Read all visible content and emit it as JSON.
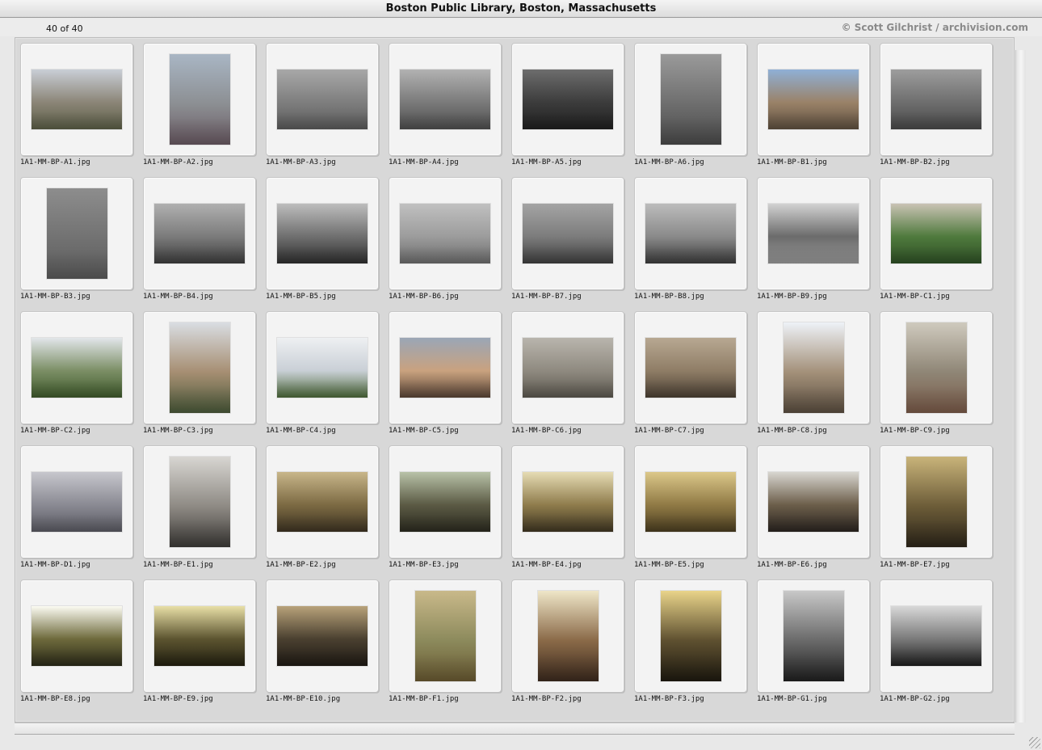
{
  "window": {
    "title": "Boston Public Library, Boston, Massachusetts"
  },
  "info": {
    "count": "40 of 40",
    "credit": "© Scott Gilchrist / archivision.com"
  },
  "slides": [
    {
      "file": "1A1-MM-BP-A1.jpg",
      "orient": "landscape",
      "tone": [
        "#c9ced6",
        "#8b8577",
        "#5b5e46"
      ]
    },
    {
      "file": "1A1-MM-BP-A2.jpg",
      "orient": "portrait",
      "tone": [
        "#a9b6c4",
        "#8c8f93",
        "#6a5a63"
      ]
    },
    {
      "file": "1A1-MM-BP-A3.jpg",
      "orient": "landscape",
      "tone": [
        "#a8a8a8",
        "#7e7e7e",
        "#5a5a5a"
      ]
    },
    {
      "file": "1A1-MM-BP-A4.jpg",
      "orient": "landscape",
      "tone": [
        "#b2b2b2",
        "#7a7a7a",
        "#4e4e4e"
      ]
    },
    {
      "file": "1A1-MM-BP-A5.jpg",
      "orient": "landscape",
      "tone": [
        "#6d6d6d",
        "#3c3c3c",
        "#1f1f1f"
      ]
    },
    {
      "file": "1A1-MM-BP-A6.jpg",
      "orient": "portrait",
      "tone": [
        "#9a9a9a",
        "#6e6e6e",
        "#4a4a4a"
      ]
    },
    {
      "file": "1A1-MM-BP-B1.jpg",
      "orient": "landscape",
      "tone": [
        "#8fb0d6",
        "#9a8268",
        "#5e4f3f"
      ]
    },
    {
      "file": "1A1-MM-BP-B2.jpg",
      "orient": "landscape",
      "tone": [
        "#9d9d9d",
        "#6e6e6e",
        "#484848"
      ]
    },
    {
      "file": "1A1-MM-BP-B3.jpg",
      "orient": "portrait",
      "tone": [
        "#8d8d8d",
        "#727272",
        "#5b5b5b"
      ]
    },
    {
      "file": "1A1-MM-BP-B4.jpg",
      "orient": "landscape",
      "tone": [
        "#b0b0b0",
        "#7b7b7b",
        "#3d3d3d"
      ]
    },
    {
      "file": "1A1-MM-BP-B5.jpg",
      "orient": "landscape",
      "tone": [
        "#bdbdbd",
        "#6f6f6f",
        "#2e2e2e"
      ]
    },
    {
      "file": "1A1-MM-BP-B6.jpg",
      "orient": "landscape",
      "tone": [
        "#c0c0c0",
        "#9c9c9c",
        "#6c6c6c"
      ]
    },
    {
      "file": "1A1-MM-BP-B7.jpg",
      "orient": "landscape",
      "tone": [
        "#a4a4a4",
        "#7c7c7c",
        "#3f3f3f"
      ]
    },
    {
      "file": "1A1-MM-BP-B8.jpg",
      "orient": "landscape",
      "tone": [
        "#bcbcbc",
        "#8a8a8a",
        "#3c3c3c"
      ]
    },
    {
      "file": "1A1-MM-BP-B9.jpg",
      "orient": "landscape",
      "tone": [
        "#d2d2d2",
        "#6b6b6b",
        "#9a9a9a"
      ]
    },
    {
      "file": "1A1-MM-BP-C1.jpg",
      "orient": "landscape",
      "tone": [
        "#c9c3b4",
        "#4f7a3d",
        "#2e4f25"
      ]
    },
    {
      "file": "1A1-MM-BP-C2.jpg",
      "orient": "landscape",
      "tone": [
        "#e2e6ea",
        "#7b8e65",
        "#3f5a2c"
      ]
    },
    {
      "file": "1A1-MM-BP-C3.jpg",
      "orient": "portrait",
      "tone": [
        "#d9dde2",
        "#a68e72",
        "#4a5a3a"
      ]
    },
    {
      "file": "1A1-MM-BP-C4.jpg",
      "orient": "landscape",
      "tone": [
        "#eef0f2",
        "#c9cfd6",
        "#4d6a3a"
      ]
    },
    {
      "file": "1A1-MM-BP-C5.jpg",
      "orient": "landscape",
      "tone": [
        "#9aa6b6",
        "#c9a27f",
        "#5a4537"
      ]
    },
    {
      "file": "1A1-MM-BP-C6.jpg",
      "orient": "landscape",
      "tone": [
        "#b9b5ad",
        "#8f8a80",
        "#5c584f"
      ]
    },
    {
      "file": "1A1-MM-BP-C7.jpg",
      "orient": "landscape",
      "tone": [
        "#b8a892",
        "#8f7d66",
        "#4b4034"
      ]
    },
    {
      "file": "1A1-MM-BP-C8.jpg",
      "orient": "portrait",
      "tone": [
        "#eef2f7",
        "#a39079",
        "#5b4e40"
      ]
    },
    {
      "file": "1A1-MM-BP-C9.jpg",
      "orient": "portrait",
      "tone": [
        "#cfcabe",
        "#8f8676",
        "#7a5a48"
      ]
    },
    {
      "file": "1A1-MM-BP-D1.jpg",
      "orient": "landscape",
      "tone": [
        "#c7c7cd",
        "#8a8a93",
        "#5a5a62"
      ]
    },
    {
      "file": "1A1-MM-BP-E1.jpg",
      "orient": "portrait",
      "tone": [
        "#d8d6d2",
        "#8e8a84",
        "#3d3b38"
      ]
    },
    {
      "file": "1A1-MM-BP-E2.jpg",
      "orient": "landscape",
      "tone": [
        "#c8b68a",
        "#7c6a43",
        "#3d3322"
      ]
    },
    {
      "file": "1A1-MM-BP-E3.jpg",
      "orient": "landscape",
      "tone": [
        "#b8c2a8",
        "#5b5a44",
        "#2b2a1f"
      ]
    },
    {
      "file": "1A1-MM-BP-E4.jpg",
      "orient": "landscape",
      "tone": [
        "#e6dcb4",
        "#8f7c4c",
        "#3f3622"
      ]
    },
    {
      "file": "1A1-MM-BP-E5.jpg",
      "orient": "landscape",
      "tone": [
        "#dcc88a",
        "#907a45",
        "#4a3d20"
      ]
    },
    {
      "file": "1A1-MM-BP-E6.jpg",
      "orient": "landscape",
      "tone": [
        "#d8d6d0",
        "#6c5e4a",
        "#2a2420"
      ]
    },
    {
      "file": "1A1-MM-BP-E7.jpg",
      "orient": "portrait",
      "tone": [
        "#c9b47a",
        "#6c5c38",
        "#2d261a"
      ]
    },
    {
      "file": "1A1-MM-BP-E8.jpg",
      "orient": "landscape",
      "tone": [
        "#fbfbf2",
        "#6e6a3c",
        "#2b2a18"
      ]
    },
    {
      "file": "1A1-MM-BP-E9.jpg",
      "orient": "landscape",
      "tone": [
        "#e8dfa6",
        "#5c5430",
        "#232010"
      ]
    },
    {
      "file": "1A1-MM-BP-E10.jpg",
      "orient": "landscape",
      "tone": [
        "#b8a27a",
        "#4a4030",
        "#1f1a14"
      ]
    },
    {
      "file": "1A1-MM-BP-F1.jpg",
      "orient": "portrait",
      "tone": [
        "#c9b98a",
        "#8c8a5c",
        "#6a5a32"
      ]
    },
    {
      "file": "1A1-MM-BP-F2.jpg",
      "orient": "portrait",
      "tone": [
        "#efe6c8",
        "#8a6a48",
        "#3c2a1e"
      ]
    },
    {
      "file": "1A1-MM-BP-F3.jpg",
      "orient": "portrait",
      "tone": [
        "#e9d48a",
        "#5e5030",
        "#1e1a10"
      ]
    },
    {
      "file": "1A1-MM-BP-G1.jpg",
      "orient": "portrait",
      "tone": [
        "#c8c8c8",
        "#6a6a6a",
        "#202020"
      ]
    },
    {
      "file": "1A1-MM-BP-G2.jpg",
      "orient": "landscape",
      "tone": [
        "#d8d8d8",
        "#7a7a7a",
        "#1e1e1e"
      ]
    }
  ]
}
